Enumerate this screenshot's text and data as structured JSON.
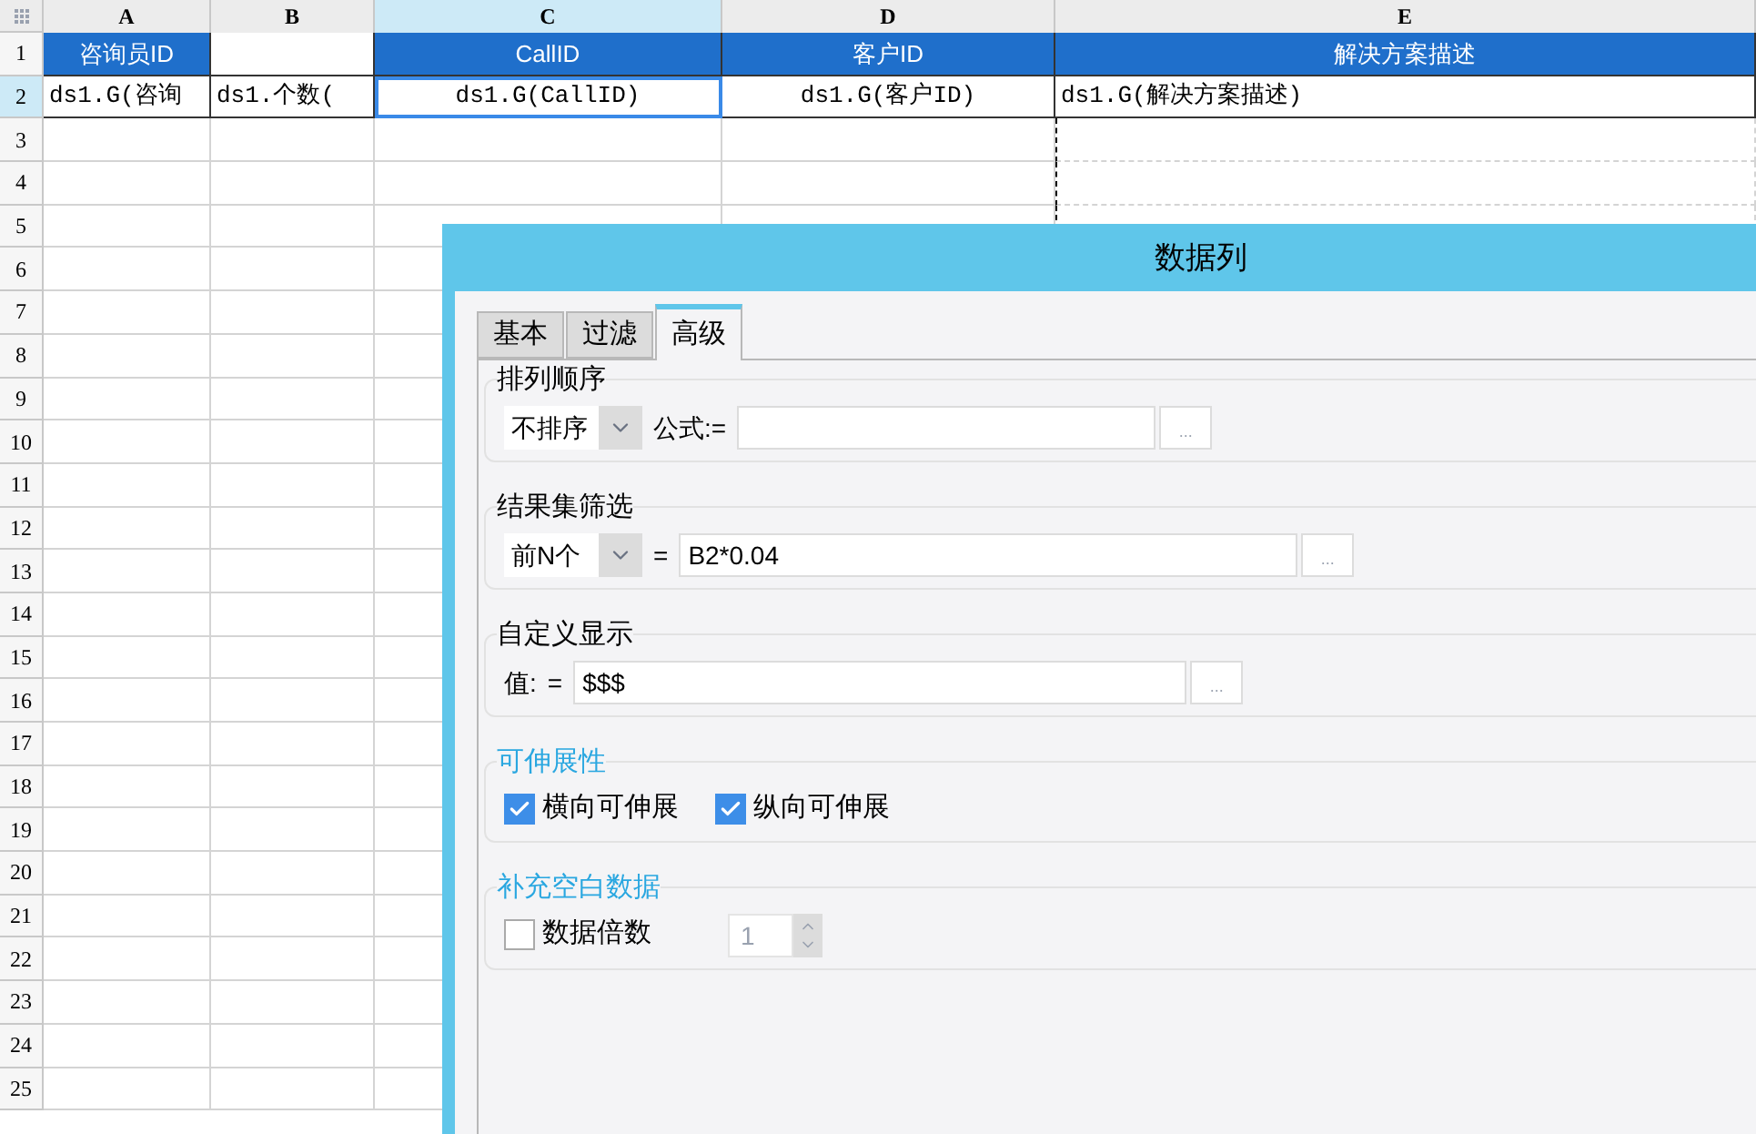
{
  "columns": [
    {
      "label": "A",
      "selected": false
    },
    {
      "label": "B",
      "selected": false
    },
    {
      "label": "C",
      "selected": true
    },
    {
      "label": "D",
      "selected": false
    },
    {
      "label": "E",
      "selected": false
    }
  ],
  "rows": [
    {
      "number": "1",
      "selected": false,
      "cells": [
        {
          "kind": "header",
          "text": "咨询员ID",
          "selected": false
        },
        {
          "kind": "blank",
          "selected": false
        },
        {
          "kind": "header",
          "text": "CallID",
          "selected": false
        },
        {
          "kind": "header",
          "text": "客户ID",
          "selected": false
        },
        {
          "kind": "header",
          "text": "解决方案描述",
          "selected": false
        }
      ]
    },
    {
      "number": "2",
      "selected": true,
      "cells": [
        {
          "kind": "data",
          "text": "ds1.G(咨询",
          "selected": false
        },
        {
          "kind": "data",
          "text": "ds1.个数(",
          "selected": false
        },
        {
          "kind": "data",
          "text": "ds1.G(CallID)",
          "selected": true
        },
        {
          "kind": "data",
          "text": "ds1.G(客户ID)",
          "selected": false
        },
        {
          "kind": "data",
          "text": "ds1.G(解决方案描述)",
          "selected": false
        }
      ]
    },
    {
      "number": "3",
      "selected": false
    },
    {
      "number": "4",
      "selected": false
    },
    {
      "number": "5",
      "selected": false
    },
    {
      "number": "6",
      "selected": false
    },
    {
      "number": "7",
      "selected": false
    },
    {
      "number": "8",
      "selected": false
    },
    {
      "number": "9",
      "selected": false
    },
    {
      "number": "10",
      "selected": false
    },
    {
      "number": "11",
      "selected": false
    },
    {
      "number": "12",
      "selected": false
    },
    {
      "number": "13",
      "selected": false
    },
    {
      "number": "14",
      "selected": false
    },
    {
      "number": "15",
      "selected": false
    },
    {
      "number": "16",
      "selected": false
    },
    {
      "number": "17",
      "selected": false
    },
    {
      "number": "18",
      "selected": false
    },
    {
      "number": "19",
      "selected": false
    },
    {
      "number": "20",
      "selected": false
    },
    {
      "number": "21",
      "selected": false
    },
    {
      "number": "22",
      "selected": false
    },
    {
      "number": "23",
      "selected": false
    },
    {
      "number": "24",
      "selected": false
    },
    {
      "number": "25",
      "selected": false
    }
  ],
  "dialog": {
    "title": "数据列",
    "tabs": [
      {
        "label": "基本",
        "selected": false
      },
      {
        "label": "过滤",
        "selected": false
      },
      {
        "label": "高级",
        "selected": true
      }
    ],
    "sections": [
      {
        "title": "排列顺序",
        "accent": false,
        "controls": [
          {
            "kind": "select",
            "value": "不排序"
          },
          {
            "kind": "label",
            "text": "公式:="
          },
          {
            "kind": "formula",
            "button": "..."
          }
        ]
      },
      {
        "title": "结果集筛选",
        "accent": false,
        "controls": [
          {
            "kind": "select",
            "value": "前N个"
          },
          {
            "kind": "label",
            "text": "="
          },
          {
            "kind": "formula",
            "value": "B2*0.04",
            "button": "..."
          }
        ]
      },
      {
        "title": "自定义显示",
        "accent": false,
        "controls": [
          {
            "kind": "label",
            "text": "值:"
          },
          {
            "kind": "label",
            "text": "="
          },
          {
            "kind": "formula",
            "value": "$$$",
            "button": "..."
          }
        ]
      },
      {
        "title": "可伸展性",
        "accent": true,
        "controls": [
          {
            "kind": "checkbox",
            "label": "横向可伸展",
            "checked": true
          },
          {
            "kind": "checkbox",
            "label": "纵向可伸展",
            "checked": true
          }
        ]
      },
      {
        "title": "补充空白数据",
        "accent": true,
        "controls": [
          {
            "kind": "checkbox",
            "label": "数据倍数",
            "checked": false
          },
          {
            "kind": "spinner",
            "value": "1",
            "disabled": true
          }
        ]
      }
    ]
  }
}
